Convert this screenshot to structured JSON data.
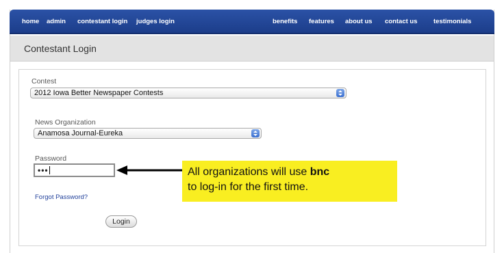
{
  "nav": {
    "left": [
      "home",
      "admin",
      "contestant login",
      "judges login"
    ],
    "right": [
      "benefits",
      "features",
      "about us",
      "contact us",
      "testimonials"
    ]
  },
  "page": {
    "title": "Contestant Login"
  },
  "form": {
    "contest_label": "Contest",
    "contest_value": "2012 Iowa Better Newspaper Contests",
    "org_label": "News Organization",
    "org_value": "Anamosa Journal-Eureka",
    "password_label": "Password",
    "password_value": "•••",
    "forgot_link": "Forgot Password?",
    "login_button": "Login"
  },
  "callout": {
    "line1_pre": "All organizations will use ",
    "line1_bold": "bnc",
    "line2": "to log-in for the first time."
  },
  "colors": {
    "nav_bg": "#1f4596",
    "callout_bg": "#f9ee21",
    "link": "#1f3f9a"
  }
}
